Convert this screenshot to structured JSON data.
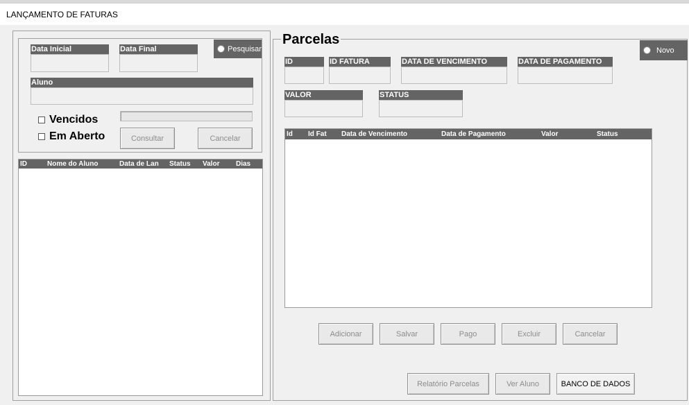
{
  "window": {
    "title": "LANÇAMENTO DE FATURAS"
  },
  "filter": {
    "data_inicial_label": "Data Inicial",
    "data_final_label": "Data Final",
    "pesquisar_label": "Pesquisar",
    "aluno_label": "Aluno",
    "vencidos_label": "Vencidos",
    "em_aberto_label": "Em Aberto",
    "consultar_label": "Consultar",
    "cancelar_label": "Cancelar"
  },
  "left_list": {
    "columns": [
      "ID",
      "Nome do Aluno",
      "Data de Lan",
      "Status",
      "Valor",
      "Dias"
    ]
  },
  "parcelas": {
    "title": "Parcelas",
    "novo_label": "Novo",
    "fields": {
      "id": "ID",
      "id_fatura": "ID FATURA",
      "data_vencimento": "DATA DE VENCIMENTO",
      "data_pagamento": "DATA DE PAGAMENTO",
      "valor": "VALOR",
      "status": "STATUS"
    },
    "columns": [
      "Id",
      "Id Fat",
      "Data de Vencimento",
      "Data de Pagamento",
      "Valor",
      "Status"
    ],
    "buttons": {
      "adicionar": "Adicionar",
      "salvar": "Salvar",
      "pago": "Pago",
      "excluir": "Excluir",
      "cancelar": "Cancelar"
    },
    "bottom_buttons": {
      "relatorio": "Relatório Parcelas",
      "ver_aluno": "Ver Aluno",
      "banco": "BANCO DE DADOS"
    }
  }
}
